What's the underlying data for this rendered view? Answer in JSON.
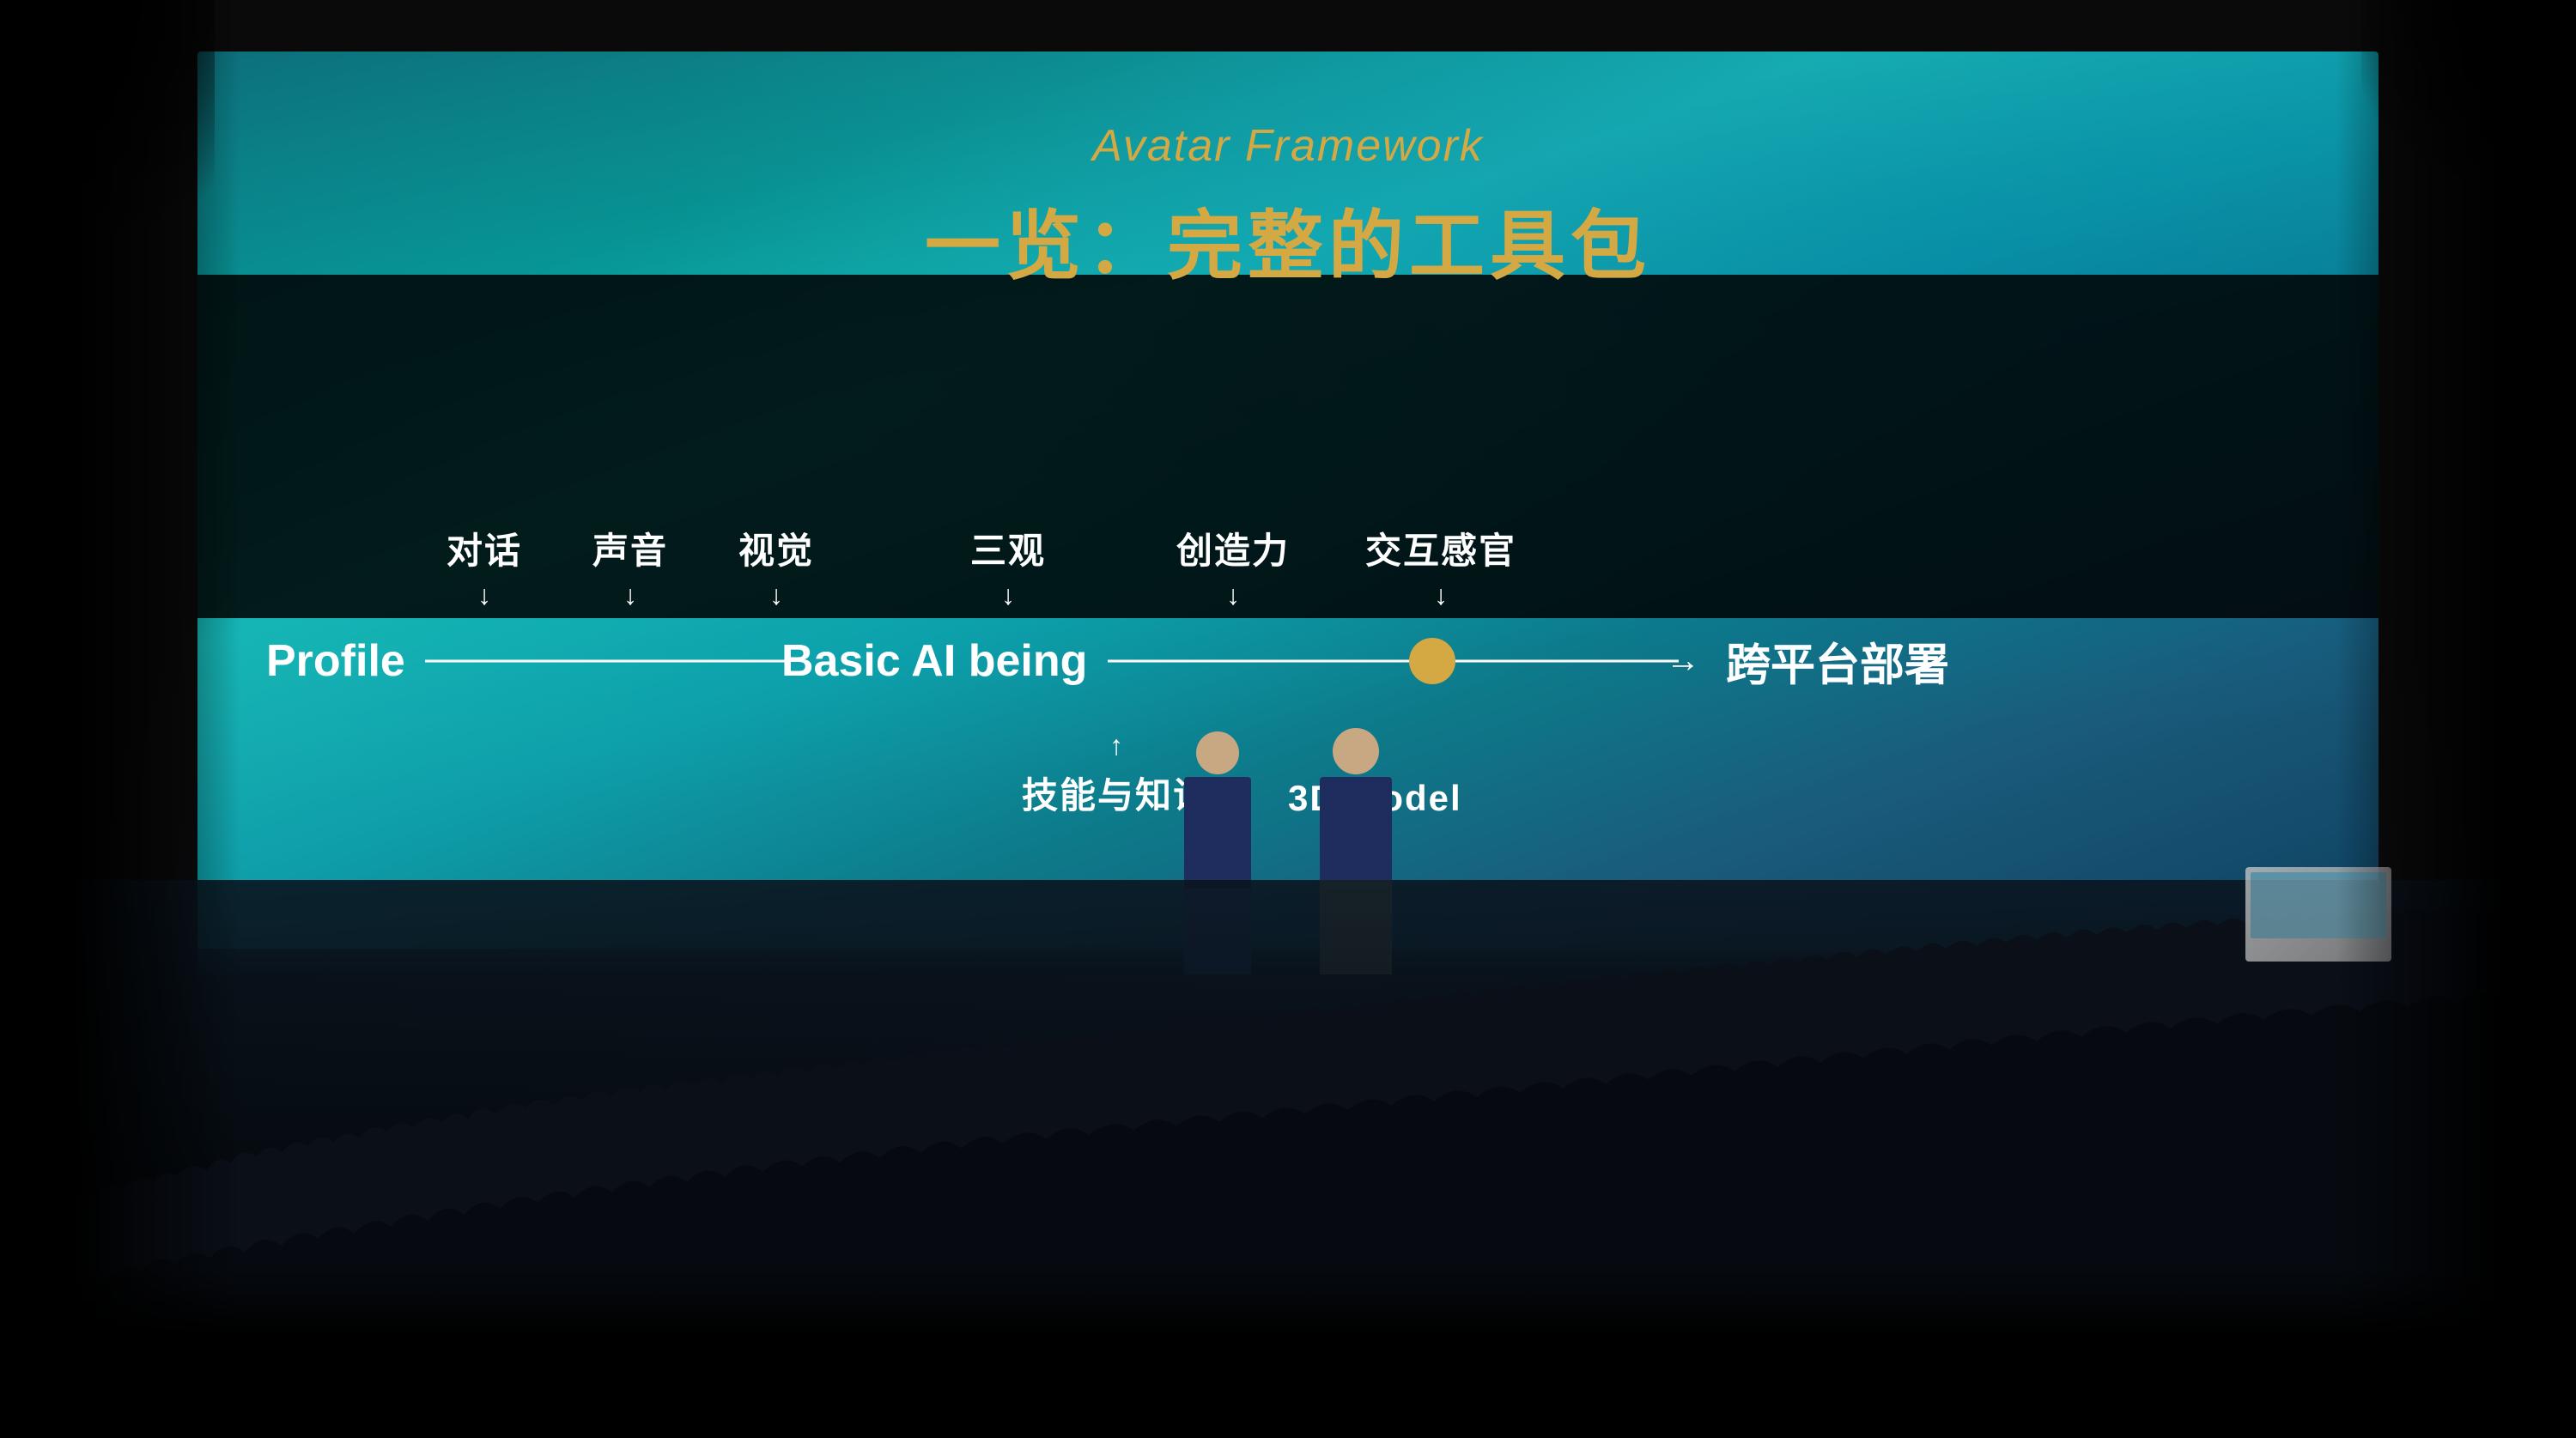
{
  "screen": {
    "title_en": "Avatar Framework",
    "title_zh": "一览：完整的工具包"
  },
  "diagram": {
    "profile_label": "Profile",
    "basic_ai_label": "Basic AI being",
    "cross_platform_label": "跨平台部署",
    "top_items": [
      {
        "text": "对话",
        "position": 240
      },
      {
        "text": "声音",
        "position": 390
      },
      {
        "text": "视觉",
        "position": 540
      },
      {
        "text": "三观",
        "position": 820
      },
      {
        "text": "创造力",
        "position": 1060
      },
      {
        "text": "交互感官",
        "position": 1300
      }
    ],
    "bottom_items": [
      {
        "text": "技能与知识",
        "position": 940
      },
      {
        "text": "3D Model",
        "position": 1200
      }
    ]
  }
}
